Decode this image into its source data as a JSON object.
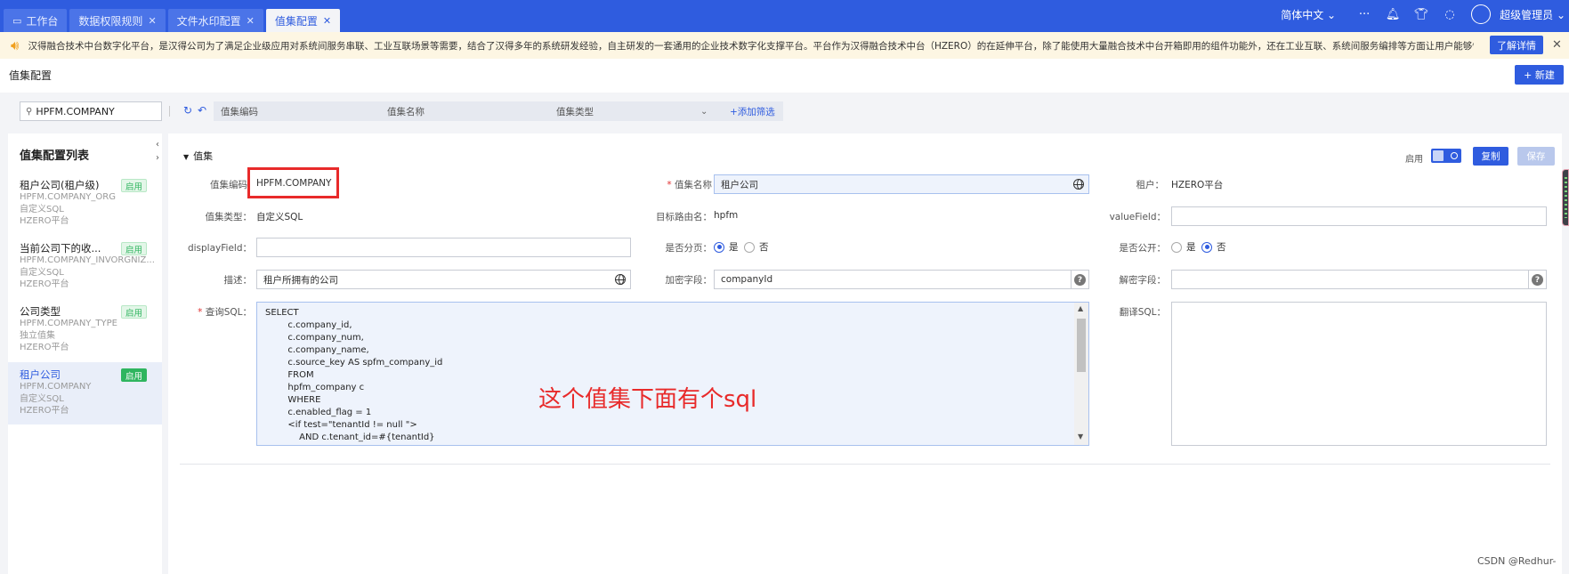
{
  "topbar": {
    "tabs": [
      {
        "label": "工作台",
        "closable": false,
        "active": false
      },
      {
        "label": "数据权限规则",
        "closable": true,
        "active": false
      },
      {
        "label": "文件水印配置",
        "closable": true,
        "active": false
      },
      {
        "label": "值集配置",
        "closable": true,
        "active": true
      }
    ],
    "language": "简体中文",
    "username": "超级管理员"
  },
  "notice": {
    "text": "汉得融合技术中台数字化平台，是汉得公司为了满足企业级应用对系统间服务串联、工业互联场景等需要，结合了汉得多年的系统研发经验，自主研发的一套通用的企业技术数字化支撑平台。平台作为汉得融合技术中台（HZERO）的在延伸平台，除了能使用大量融合技术中台开箱即用的组件功能外，还在工业互联、系统间服务编排等方面让用户能够快速接入，从而降低开发对接难度...",
    "learn_more": "了解详情"
  },
  "page": {
    "title": "值集配置",
    "new_button": "+ 新建"
  },
  "filter": {
    "search_value": "HPFM.COMPANY",
    "field_code": "值集编码",
    "field_name": "值集名称",
    "field_type": "值集类型",
    "add_filter": "+添加筛选"
  },
  "list": {
    "title": "值集配置列表",
    "items": [
      {
        "name": "租户公司(租户级)",
        "code": "HPFM.COMPANY_ORG",
        "type": "自定义SQL",
        "platform": "HZERO平台",
        "status": "启用",
        "selected": false
      },
      {
        "name": "当前公司下的收...",
        "code": "HPFM.COMPANY_INVORGNIZ...",
        "type": "自定义SQL",
        "platform": "HZERO平台",
        "status": "启用",
        "selected": false
      },
      {
        "name": "公司类型",
        "code": "HPFM.COMPANY_TYPE",
        "type": "独立值集",
        "platform": "HZERO平台",
        "status": "启用",
        "selected": false
      },
      {
        "name": "租户公司",
        "code": "HPFM.COMPANY",
        "type": "自定义SQL",
        "platform": "HZERO平台",
        "status": "启用",
        "selected": true
      }
    ]
  },
  "detail": {
    "section_title": "值集",
    "enable_label": "启用",
    "copy_button": "复制",
    "save_button": "保存",
    "labels": {
      "code": "值集编码",
      "name": "值集名称",
      "tenant": "租户：",
      "type": "值集类型：",
      "route": "目标路由名：",
      "value_field": "valueField：",
      "display_field": "displayField：",
      "paging": "是否分页：",
      "public": "是否公开：",
      "description": "描述：",
      "encrypt": "加密字段：",
      "decrypt": "解密字段：",
      "query_sql": "查询SQL：",
      "translate_sql": "翻译SQL："
    },
    "values": {
      "code": "HPFM.COMPANY",
      "name": "租户公司",
      "tenant": "HZERO平台",
      "type": "自定义SQL",
      "route": "hpfm",
      "value_field": "",
      "display_field": "",
      "description": "租户所拥有的公司",
      "encrypt": "companyId",
      "decrypt": "",
      "yes": "是",
      "no": "否"
    },
    "sql_lines": [
      "SELECT",
      "        c.company_id,",
      "        c.company_num,",
      "        c.company_name,",
      "        c.source_key AS spfm_company_id",
      "        FROM",
      "        hpfm_company c",
      "        WHERE",
      "        c.enabled_flag = 1",
      "        <if test=\"tenantId != null \">",
      "            AND c.tenant_id=#{tenantId}"
    ]
  },
  "annotation": "这个值集下面有个sql",
  "watermark": "CSDN @Redhur-"
}
